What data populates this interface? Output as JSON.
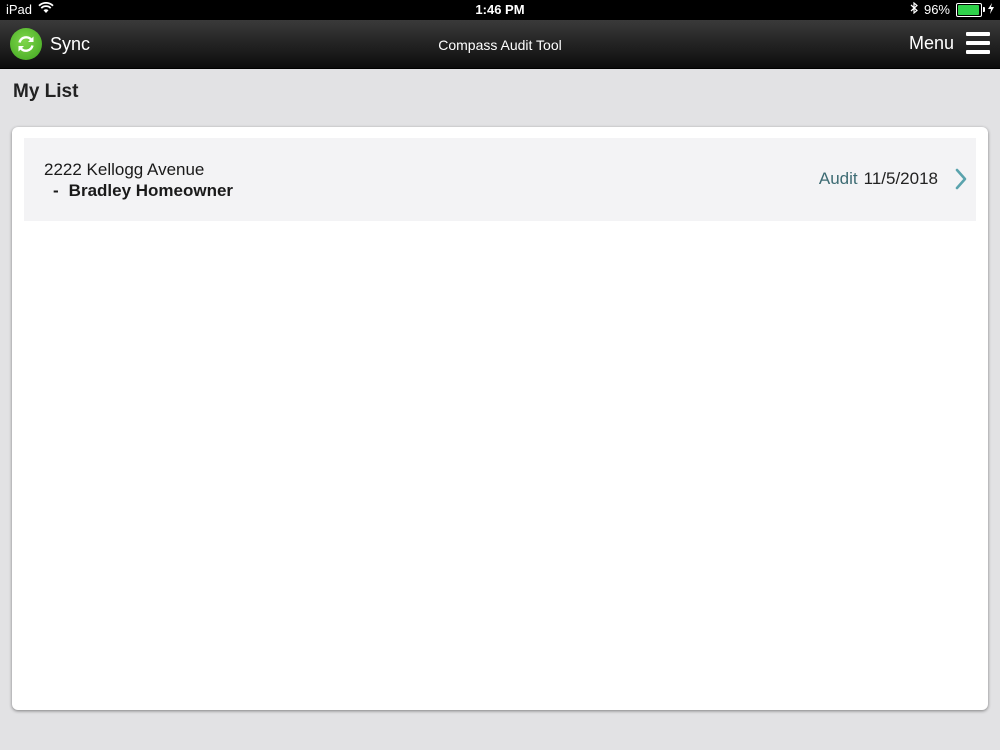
{
  "status_bar": {
    "device": "iPad",
    "time": "1:46 PM",
    "battery_percent": "96%",
    "battery_level": 0.96,
    "icons": [
      "wifi-icon",
      "bluetooth-icon",
      "battery-icon",
      "charging-icon"
    ]
  },
  "nav_bar": {
    "sync_label": "Sync",
    "title": "Compass Audit Tool",
    "menu_label": "Menu"
  },
  "page": {
    "title": "My List"
  },
  "list": {
    "items": [
      {
        "address": "2222 Kellogg Avenue",
        "owner_dash": "-",
        "owner": "Bradley Homeowner",
        "type": "Audit",
        "date": "11/5/2018"
      }
    ]
  },
  "colors": {
    "sync_green": "#4cb82a",
    "battery_green": "#2fd14a",
    "accent_teal": "#3d6b73",
    "chevron": "#5aa3ad"
  }
}
